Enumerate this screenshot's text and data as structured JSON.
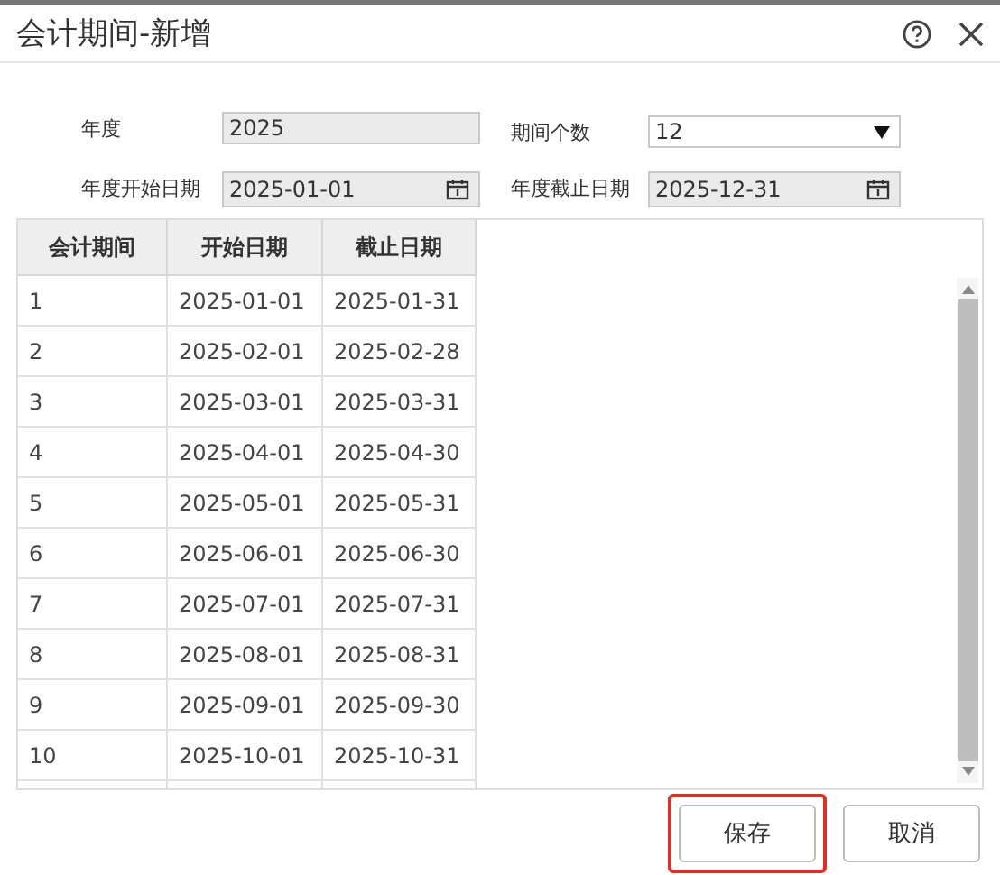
{
  "window": {
    "title": "会计期间-新增"
  },
  "form": [
    {
      "kind": "text",
      "label": "年度",
      "value": "2025",
      "disabled": true
    },
    {
      "kind": "select",
      "label": "期间个数",
      "value": "12",
      "disabled": false
    },
    {
      "kind": "date",
      "label": "年度开始日期",
      "value": "2025-01-01",
      "disabled": true
    },
    {
      "kind": "date",
      "label": "年度截止日期",
      "value": "2025-12-31",
      "disabled": true
    }
  ],
  "table": {
    "columns": [
      "会计期间",
      "开始日期",
      "截止日期"
    ],
    "rows": [
      [
        "1",
        "2025-01-01",
        "2025-01-31"
      ],
      [
        "2",
        "2025-02-01",
        "2025-02-28"
      ],
      [
        "3",
        "2025-03-01",
        "2025-03-31"
      ],
      [
        "4",
        "2025-04-01",
        "2025-04-30"
      ],
      [
        "5",
        "2025-05-01",
        "2025-05-31"
      ],
      [
        "6",
        "2025-06-01",
        "2025-06-30"
      ],
      [
        "7",
        "2025-07-01",
        "2025-07-31"
      ],
      [
        "8",
        "2025-08-01",
        "2025-08-31"
      ],
      [
        "9",
        "2025-09-01",
        "2025-09-30"
      ],
      [
        "10",
        "2025-10-01",
        "2025-10-31"
      ]
    ]
  },
  "buttons": [
    {
      "label": "保存",
      "highlighted": true
    },
    {
      "label": "取消",
      "highlighted": false
    }
  ]
}
